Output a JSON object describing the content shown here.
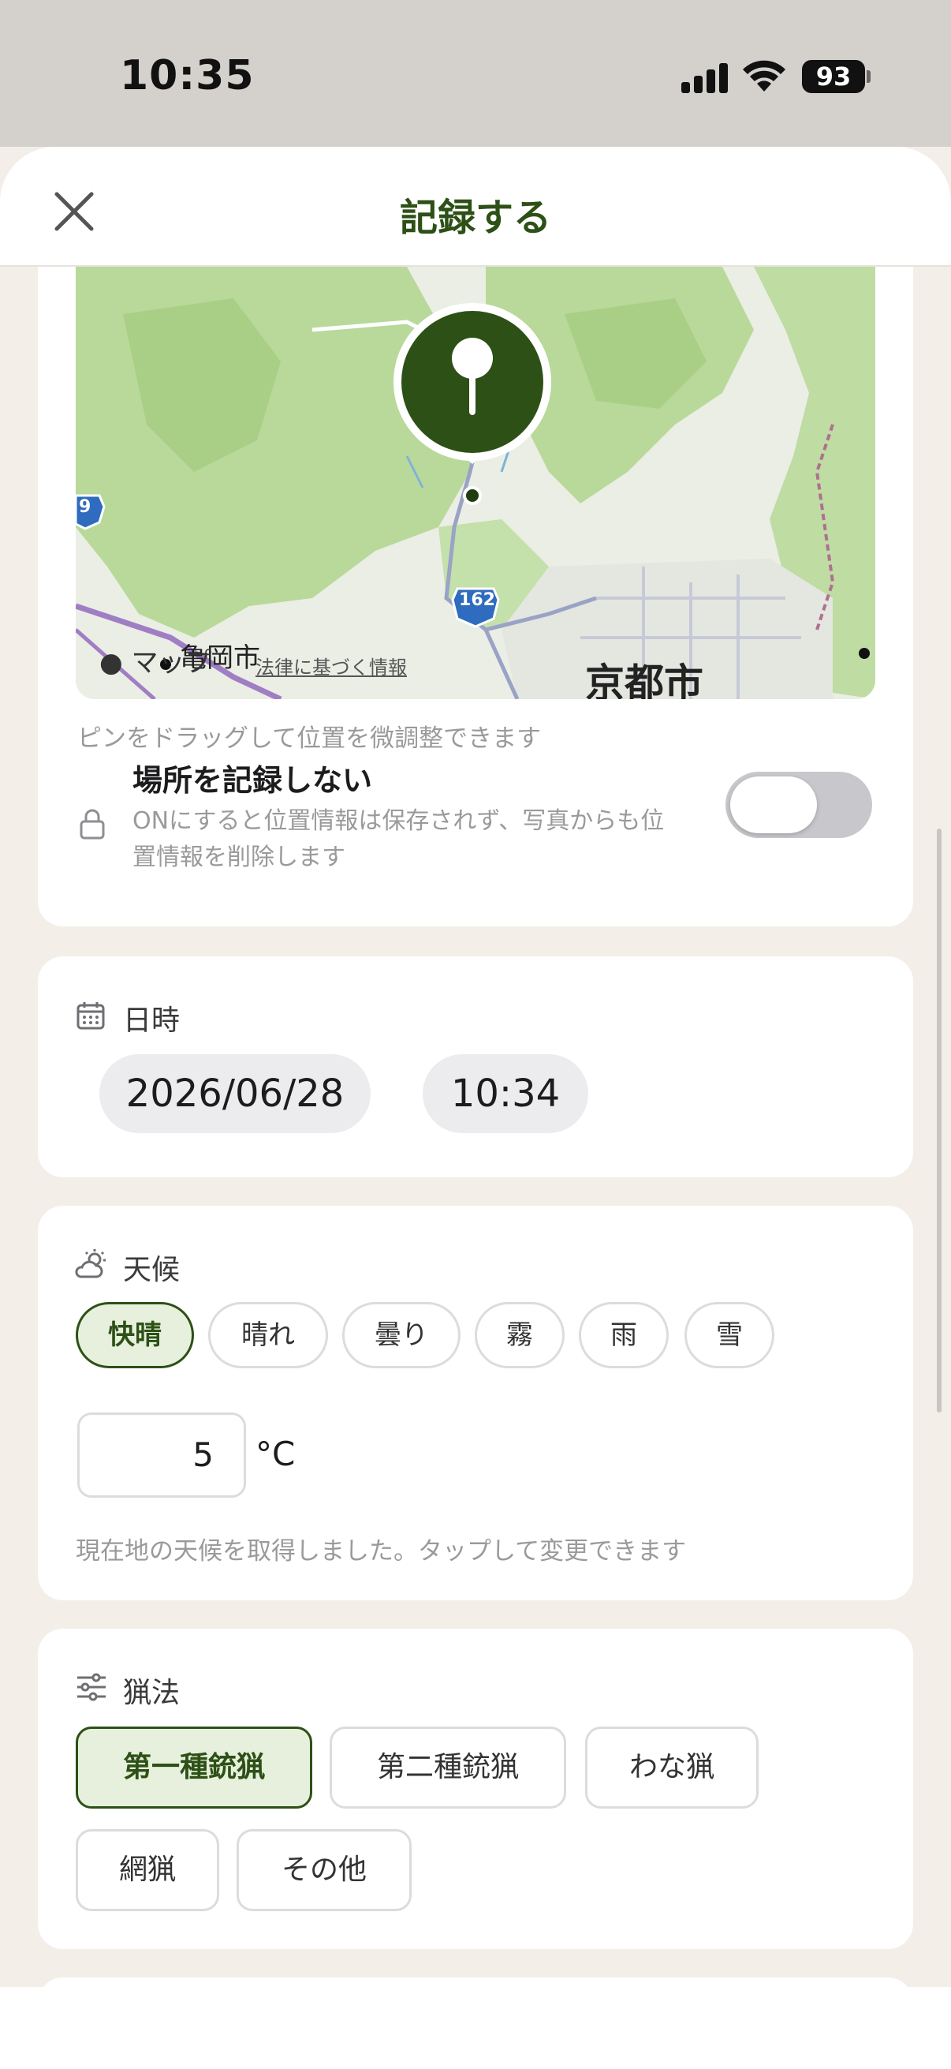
{
  "status_bar": {
    "time": "10:35",
    "battery": "93"
  },
  "header": {
    "title": "記録する",
    "close_icon": "close-icon"
  },
  "location": {
    "map_city_main": "京都市",
    "map_city_small": "亀岡市",
    "map_route_162": "162",
    "map_route_9": "9",
    "map_logo": " マップ",
    "map_legal": "法律に基づく情報",
    "hint": "ピンをドラッグして位置を微調整できます",
    "no_record_label": "場所を記録しない",
    "no_record_desc_line1": "ONにすると位置情報は保存されず、写真からも位",
    "no_record_desc_line2": "置情報を削除します",
    "toggle_on": false
  },
  "datetime": {
    "title": "日時",
    "date": "2026/06/28",
    "time": "10:34"
  },
  "weather": {
    "title": "天候",
    "options": [
      "快晴",
      "晴れ",
      "曇り",
      "霧",
      "雨",
      "雪"
    ],
    "selected": "快晴",
    "temperature": "5",
    "unit": "°C",
    "hint": "現在地の天候を取得しました。タップして変更できます"
  },
  "method": {
    "title": "猟法",
    "options": [
      "第一種銃猟",
      "第二種銃猟",
      "わな猟",
      "網猟",
      "その他"
    ],
    "selected": "第一種銃猟"
  },
  "colors": {
    "accent": "#2d5016",
    "accent_bg": "#e6f0dc",
    "background": "#f3efe8"
  }
}
